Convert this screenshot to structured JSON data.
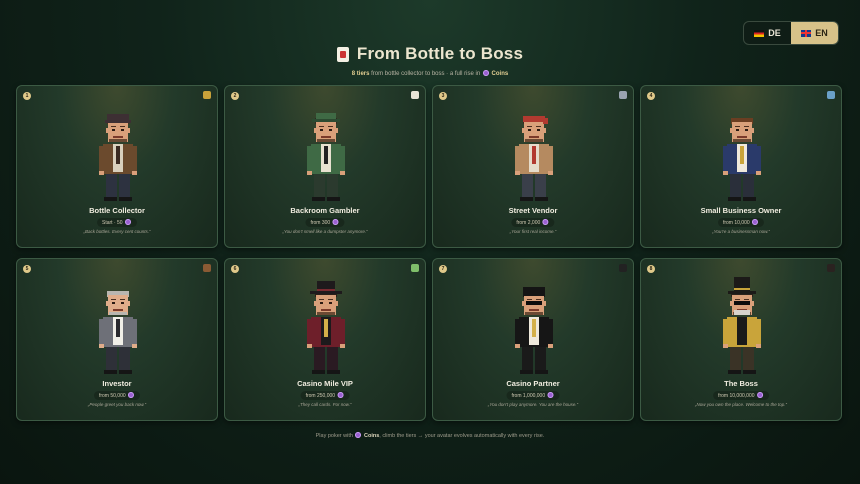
{
  "lang": {
    "de": "DE",
    "en": "EN",
    "active": "en"
  },
  "header": {
    "title": "From Bottle to Boss",
    "sub_tiers": "8 tiers",
    "sub_mid": "from bottle collector to boss · a full rise in",
    "sub_coins": "Coins"
  },
  "tiers": [
    {
      "num": "1",
      "name": "Bottle Collector",
      "price": "Start · 50",
      "quote": "„Back bottles. Every cent counts.“",
      "icon": "bottle-icon",
      "hat": "cap",
      "colors": {
        "hat": "#3d2f33",
        "hair": "#4a2e1f",
        "skin": "#d9a07a",
        "coat": "#6b4a2d",
        "shirt": "#d9d0bd",
        "tie": "#3a2a22",
        "pants": "#2d3240"
      }
    },
    {
      "num": "2",
      "name": "Backroom Gambler",
      "price": "from 300",
      "quote": "„You don’t smell like a dumpster anymore.“",
      "icon": "playing-card-icon",
      "hat": "flatcap",
      "colors": {
        "hat": "#3f6a45",
        "hair": "#2f2a22",
        "skin": "#d9a07a",
        "coat": "#3f6a45",
        "shirt": "#e8e2d0",
        "tie": "#222222",
        "pants": "#2b3a2e"
      }
    },
    {
      "num": "3",
      "name": "Street Vendor",
      "price": "from 2,000",
      "quote": "„Your first real income.“",
      "icon": "cart-icon",
      "hat": "bandana",
      "colors": {
        "hat": "#b23a30",
        "hair": "#3b2a20",
        "skin": "#d9a07a",
        "coat": "#b58a60",
        "shirt": "#e6dccb",
        "tie": "#b23a30",
        "pants": "#3a3f4a"
      }
    },
    {
      "num": "4",
      "name": "Small Business Owner",
      "price": "from 10,000",
      "quote": "„You’re a businessman now.“",
      "icon": "shop-icon",
      "hat": "none",
      "colors": {
        "hat": "#6b3e22",
        "hair": "#6b3e22",
        "skin": "#d9a07a",
        "coat": "#2a3a6a",
        "shirt": "#efe9dc",
        "tie": "#c9a43a",
        "pants": "#2a2f3a"
      }
    },
    {
      "num": "5",
      "name": "Investor",
      "price": "from 50,000",
      "quote": "„People greet you back now.“",
      "icon": "briefcase-icon",
      "hat": "none",
      "colors": {
        "hat": "#b9b6b0",
        "hair": "#b9b6b0",
        "skin": "#e0ad8a",
        "coat": "#6e7078",
        "shirt": "#f1efe8",
        "tie": "#2a2a2e",
        "pants": "#2e3038"
      }
    },
    {
      "num": "6",
      "name": "Casino Mile VIP",
      "price": "from 250,000",
      "quote": "„They call cards. For now.“",
      "icon": "money-icon",
      "hat": "fedora",
      "colors": {
        "hat": "#1e1a1c",
        "hair": "#2a1e18",
        "skin": "#d9a07a",
        "coat": "#6e1f2a",
        "shirt": "#1d1a1c",
        "tie": "#d4b04a",
        "pants": "#2a1a22"
      }
    },
    {
      "num": "7",
      "name": "Casino Partner",
      "price": "from 1,000,000",
      "quote": "„You don’t play anymore. You are the house.“",
      "icon": "sunglasses-icon",
      "hat": "slick",
      "colors": {
        "hat": "#141414",
        "hair": "#141414",
        "skin": "#d9a07a",
        "coat": "#161616",
        "shirt": "#efe9dc",
        "tie": "#d4b04a",
        "pants": "#1a1a1a"
      }
    },
    {
      "num": "8",
      "name": "The Boss",
      "price": "from 10,000,000",
      "quote": "„Now you own the place. Welcome to the top.“",
      "icon": "tophat-icon",
      "hat": "tophat",
      "colors": {
        "hat": "#1c1a18",
        "hair": "#2a221c",
        "skin": "#d9a07a",
        "coat": "#c9a43a",
        "shirt": "#1a1a1a",
        "tie": "#1a1a1a",
        "pants": "#3a3326"
      }
    }
  ],
  "footer": {
    "pre": "Play poker with",
    "coins": "Coins",
    "post": ", climb the tiers → your avatar evolves automatically with every rise."
  },
  "colors": {
    "accent": "#d7c289",
    "coin": "#9a5fd1",
    "card_border": "#3c5a44"
  }
}
